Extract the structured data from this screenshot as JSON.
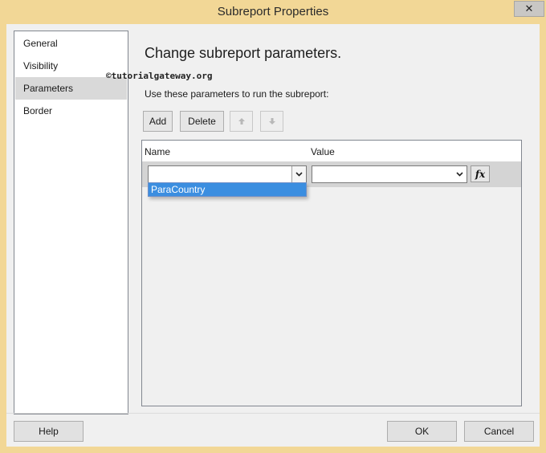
{
  "window": {
    "title": "Subreport Properties",
    "close_glyph": "✕"
  },
  "nav": {
    "items": [
      {
        "label": "General",
        "selected": false
      },
      {
        "label": "Visibility",
        "selected": false
      },
      {
        "label": "Parameters",
        "selected": true
      },
      {
        "label": "Border",
        "selected": false
      }
    ]
  },
  "main": {
    "heading": "Change subreport parameters.",
    "watermark": "©tutorialgateway.org",
    "instruction": "Use these parameters to run the subreport:"
  },
  "toolbar": {
    "add_label": "Add",
    "delete_label": "Delete",
    "move_up_icon": "arrow-up-icon",
    "move_down_icon": "arrow-down-icon"
  },
  "grid": {
    "columns": [
      "Name",
      "Value"
    ],
    "rows": [
      {
        "name": "",
        "value": ""
      }
    ],
    "fx_label": "fx"
  },
  "name_dropdown": {
    "options": [
      "ParaCountry"
    ],
    "highlighted": "ParaCountry"
  },
  "footer": {
    "help_label": "Help",
    "ok_label": "OK",
    "cancel_label": "Cancel"
  },
  "colors": {
    "titlebar": "#f2d796",
    "selection": "#3b8ee0",
    "nav_selected": "#d9d9d9"
  }
}
